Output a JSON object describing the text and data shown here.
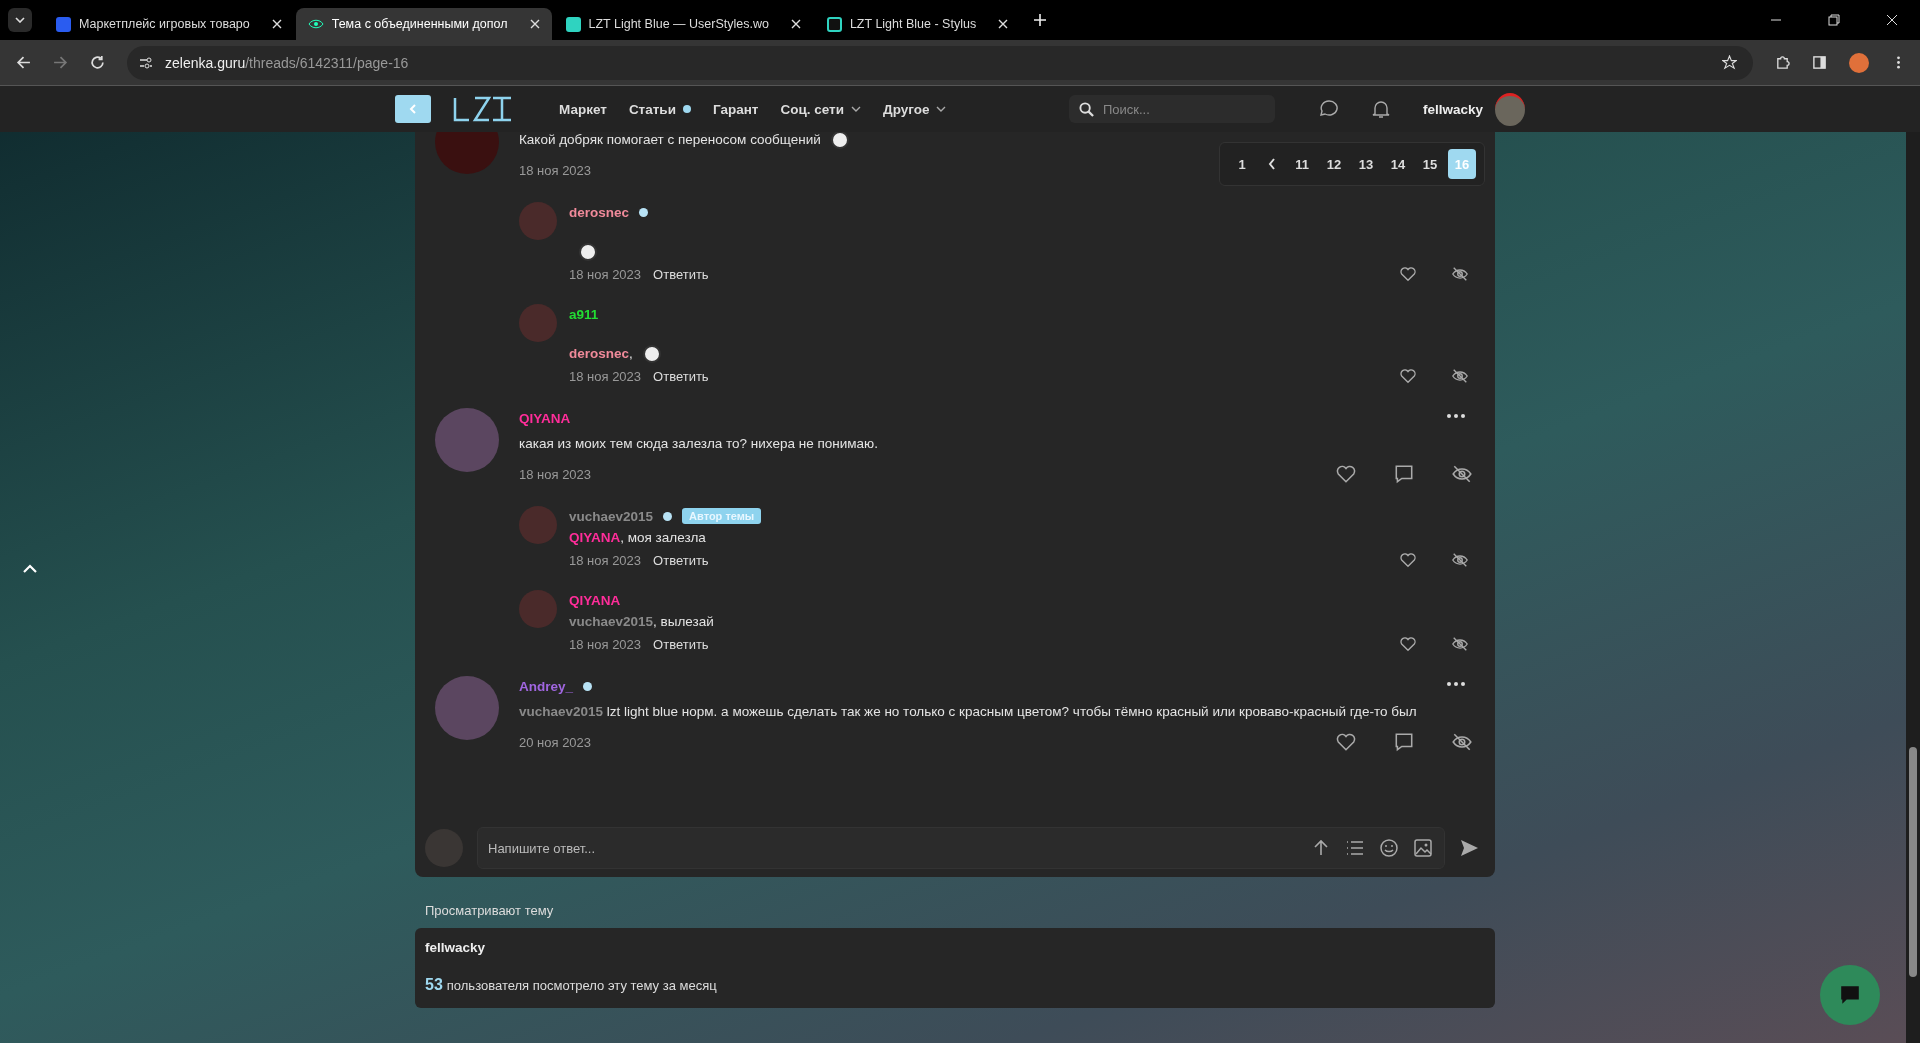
{
  "browser": {
    "tabs": [
      {
        "title": "Маркетплейс игровых товаро",
        "selected": false
      },
      {
        "title": "Тема с объединенными допол",
        "selected": true
      },
      {
        "title": "LZT Light Blue — UserStyles.wo",
        "selected": false
      },
      {
        "title": "LZT Light Blue - Stylus",
        "selected": false
      }
    ],
    "url_host": "zelenka.guru",
    "url_path": "/threads/6142311/page-16"
  },
  "site_nav": {
    "items": [
      {
        "label": "Маркет",
        "dot": false,
        "dropdown": false
      },
      {
        "label": "Статьи",
        "dot": true,
        "dropdown": false
      },
      {
        "label": "Гарант",
        "dot": false,
        "dropdown": false
      },
      {
        "label": "Соц. сети",
        "dot": false,
        "dropdown": true
      },
      {
        "label": "Другое",
        "dot": false,
        "dropdown": true
      }
    ],
    "search_placeholder": "Поиск...",
    "username": "fellwacky"
  },
  "pagination": [
    {
      "label": "1",
      "selected": false
    },
    {
      "label": "11",
      "selected": false
    },
    {
      "label": "12",
      "selected": false
    },
    {
      "label": "13",
      "selected": false
    },
    {
      "label": "14",
      "selected": false
    },
    {
      "label": "15",
      "selected": false
    },
    {
      "label": "16",
      "selected": true
    }
  ],
  "posts": [
    {
      "text": "Какой добряк помогает с переносом сообщений",
      "emoji": true,
      "date": "18 ноя 2023",
      "menu": false,
      "comments": [
        {
          "author": "derosnec",
          "color": "#f08a9a",
          "online": true,
          "emoji": true,
          "date": "18 ноя 2023",
          "reply": "Ответить"
        },
        {
          "author": "a911",
          "color": "#22dd33",
          "online": false,
          "mention": {
            "name": "derosnec",
            "color": "#f08a9a"
          },
          "text": ",",
          "emoji": true,
          "date": "18 ноя 2023",
          "reply": "Ответить"
        }
      ]
    },
    {
      "author": "QIYANA",
      "color": "#ff2d9a",
      "online": false,
      "text": "какая из моих тем сюда залезла то? нихера не понимаю.",
      "emoji": false,
      "date": "18 ноя 2023",
      "menu": true,
      "comments": [
        {
          "author": "vuchaev2015",
          "color": "#8a8a8a",
          "online": true,
          "badge": "Автор темы",
          "mention": {
            "name": "QIYANA",
            "color": "#ff2d9a"
          },
          "text": ", моя залезла",
          "emoji": false,
          "date": "18 ноя 2023",
          "reply": "Ответить"
        },
        {
          "author": "QIYANA",
          "color": "#ff2d9a",
          "online": false,
          "mention": {
            "name": "vuchaev2015",
            "color": "#8a8a8a"
          },
          "text": ", вылезай",
          "emoji": false,
          "date": "18 ноя 2023",
          "reply": "Ответить"
        }
      ]
    },
    {
      "author": "Andrey_",
      "color": "#a066e0",
      "online": true,
      "mention": {
        "name": "vuchaev2015",
        "color": "#8a8a8a"
      },
      "text": " lzt light blue норм. а можешь сделать так же но только с красным цветом? чтобы тёмно красный или кроваво-красный где-то был",
      "emoji": false,
      "date": "20 ноя 2023",
      "menu": true
    }
  ],
  "reply_placeholder": "Напишите ответ...",
  "viewers": {
    "title": "Просматривают тему",
    "names": [
      "fellwacky"
    ],
    "count": "53",
    "count_text": "пользователя посмотрело эту тему за месяц"
  }
}
